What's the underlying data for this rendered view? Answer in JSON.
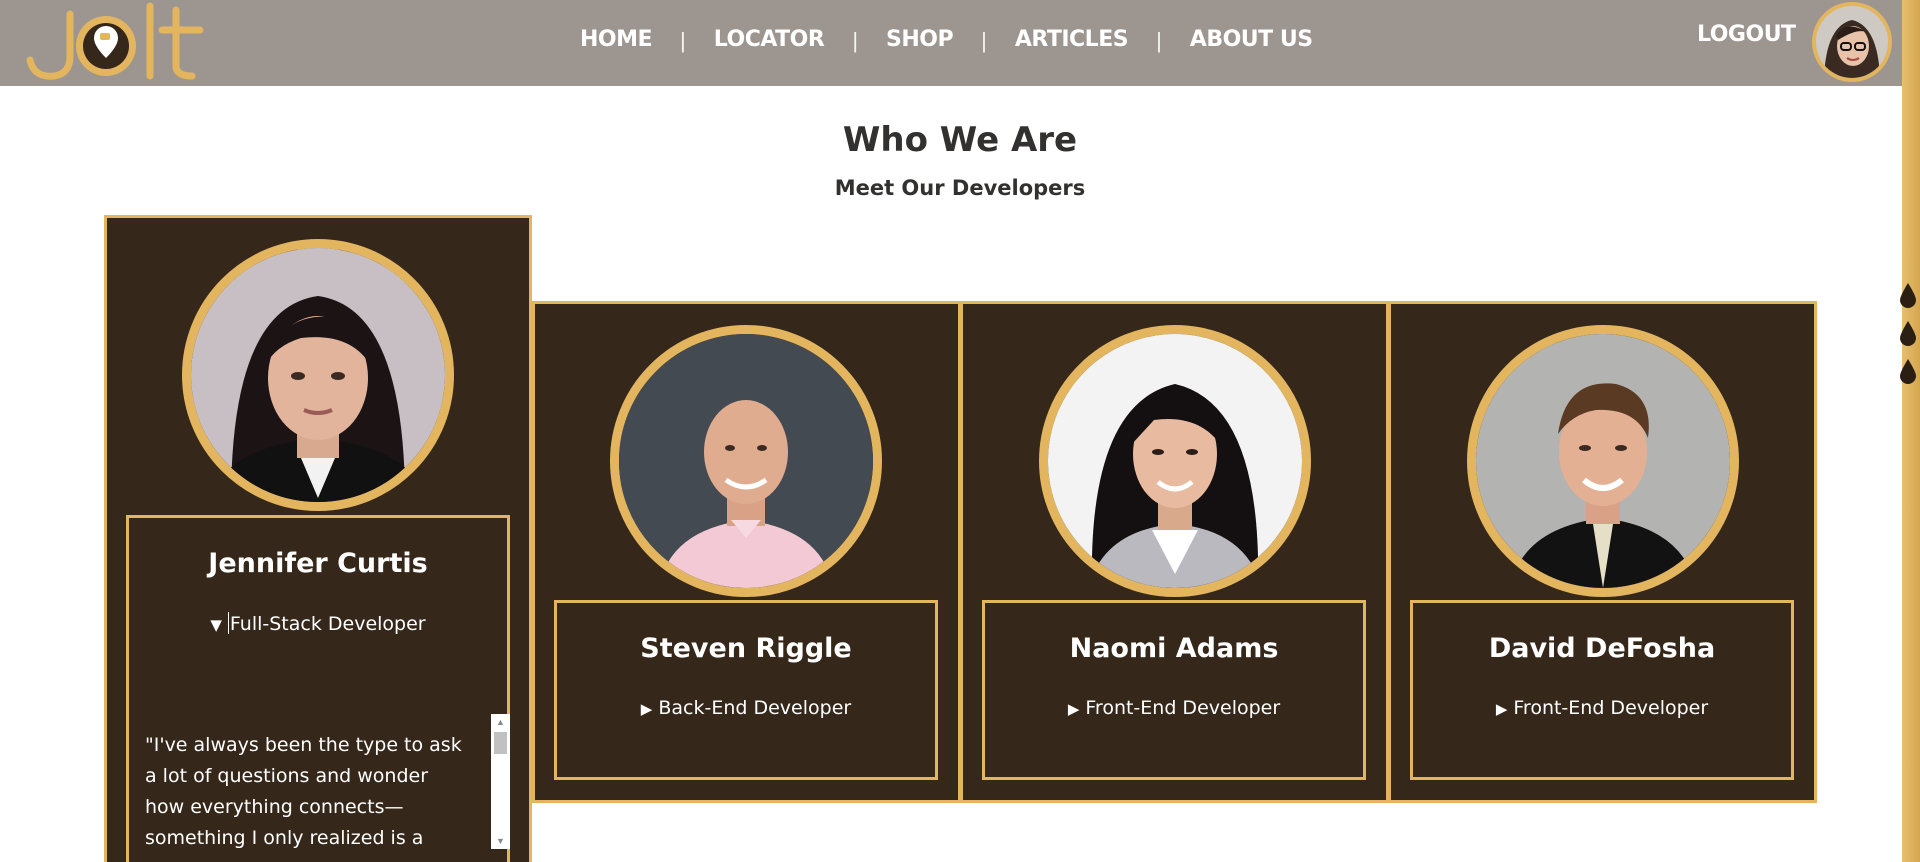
{
  "brand": {
    "logo_text": "jolt"
  },
  "nav": {
    "links": [
      "HOME",
      "LOCATOR",
      "SHOP",
      "ARTICLES",
      "ABOUT US"
    ],
    "logout_label": "LOGOUT"
  },
  "page": {
    "title": "Who We Are",
    "subtitle": "Meet Our Developers"
  },
  "developers": [
    {
      "name": "Jennifer Curtis",
      "role": "Full-Stack Developer",
      "expanded": true,
      "bio": "\"I've always been the type to ask a lot of questions and wonder how everything connects—something I only realized is a"
    },
    {
      "name": "Steven Riggle",
      "role": "Back-End Developer",
      "expanded": false
    },
    {
      "name": "Naomi Adams",
      "role": "Front-End Developer",
      "expanded": false
    },
    {
      "name": "David DeFosha",
      "role": "Front-End Developer",
      "expanded": false
    }
  ],
  "colors": {
    "nav_bg": "#9c9590",
    "gold_accent": "#e2b55e",
    "card_bg": "#35271a",
    "heading_text": "#33312f"
  },
  "icons": {
    "expanded": "triangle-down-icon",
    "collapsed": "triangle-right-icon",
    "coffee": "coffee-cup-icon",
    "drop": "coffee-drop-icon"
  }
}
